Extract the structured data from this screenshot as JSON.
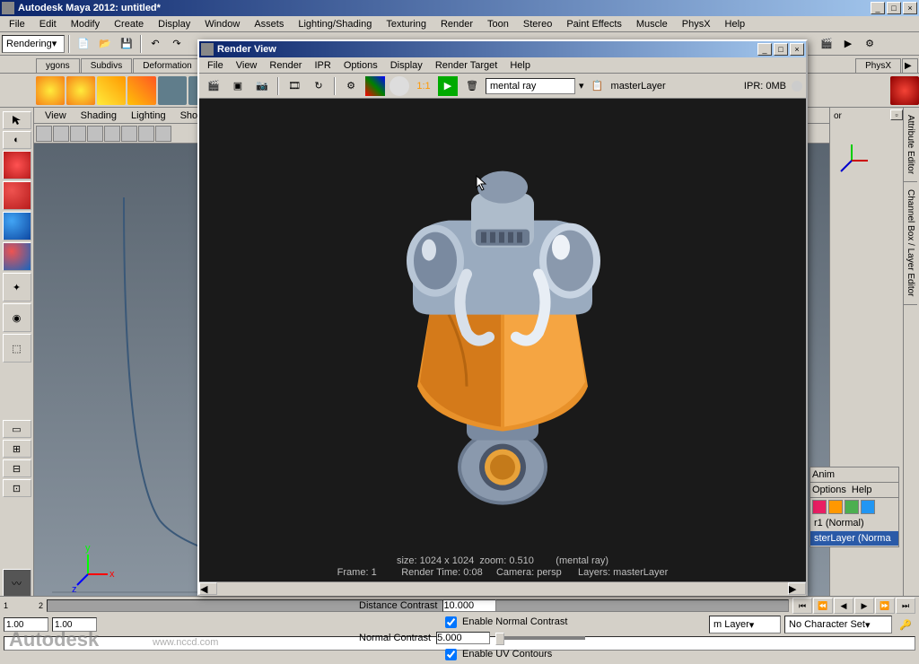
{
  "app": {
    "title": "Autodesk Maya 2012: untitled*"
  },
  "main_menu": [
    "File",
    "Edit",
    "Modify",
    "Create",
    "Display",
    "Window",
    "Assets",
    "Lighting/Shading",
    "Texturing",
    "Render",
    "Toon",
    "Stereo",
    "Paint Effects",
    "Muscle",
    "PhysX",
    "Help"
  ],
  "mode_combo": "Rendering",
  "shelf_tabs": [
    "ygons",
    "Subdivs",
    "Deformation"
  ],
  "right_shelf_tab": "PhysX",
  "viewport_menu": [
    "View",
    "Shading",
    "Lighting",
    "Show"
  ],
  "side_tabs": [
    "Attribute Editor",
    "Channel Box / Layer Editor"
  ],
  "render_view": {
    "title": "Render View",
    "menu": [
      "File",
      "View",
      "Render",
      "IPR",
      "Options",
      "Display",
      "Render Target",
      "Help"
    ],
    "renderer": "mental ray",
    "layer": "masterLayer",
    "ipr": "IPR: 0MB",
    "info_line1": "size: 1024 x 1024  zoom: 0.510        (mental ray)",
    "info_line2": "Frame: 1         Render Time: 0:08     Camera: persp      Layers: masterLayer"
  },
  "settings": {
    "distance_contrast_label": "Distance Contrast",
    "distance_contrast": "10.000",
    "enable_normal": "Enable Normal Contrast",
    "normal_contrast_label": "Normal Contrast",
    "normal_contrast": "5.000",
    "enable_uv": "Enable UV Contours"
  },
  "layer_panel": {
    "tabs": [
      "Anim"
    ],
    "menu": [
      "Options",
      "Help"
    ],
    "rows": [
      "r1 (Normal)",
      "sterLayer (Norma"
    ]
  },
  "anim": {
    "layer_combo": "m Layer",
    "charset": "No Character Set"
  },
  "timeline": {
    "start": "1.00",
    "end": "1.00"
  },
  "right_panel_suffix": "or",
  "watermark": "Autodesk",
  "watermark2": "www.nccd.com"
}
